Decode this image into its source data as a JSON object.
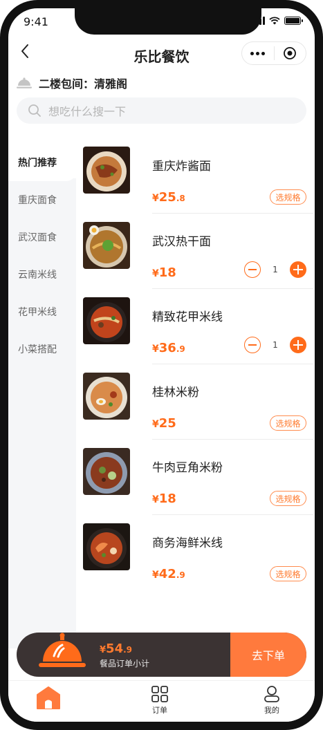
{
  "status": {
    "time": "9:41"
  },
  "nav": {
    "title": "乐比餐饮",
    "back_icon": "chevron-left-icon",
    "more_icon": "more-dots-icon",
    "close_icon": "target-circle-icon"
  },
  "room": {
    "label": "二楼包间：清雅阁",
    "icon": "cloche-icon"
  },
  "search": {
    "placeholder": "想吃什么搜一下",
    "icon": "search-icon"
  },
  "categories": [
    {
      "label": "热门推荐",
      "active": true
    },
    {
      "label": "重庆面食",
      "active": false
    },
    {
      "label": "武汉面食",
      "active": false
    },
    {
      "label": "云南米线",
      "active": false
    },
    {
      "label": "花甲米线",
      "active": false
    },
    {
      "label": "小菜搭配",
      "active": false
    }
  ],
  "dishes": [
    {
      "name": "重庆炸酱面",
      "currency": "¥",
      "price_int": "25",
      "price_dec": ".8",
      "action": "spec",
      "spec_label": "选规格"
    },
    {
      "name": "武汉热干面",
      "currency": "¥",
      "price_int": "18",
      "price_dec": "",
      "action": "stepper",
      "qty": "1"
    },
    {
      "name": "精致花甲米线",
      "currency": "¥",
      "price_int": "36",
      "price_dec": ".9",
      "action": "stepper",
      "qty": "1"
    },
    {
      "name": "桂林米粉",
      "currency": "¥",
      "price_int": "25",
      "price_dec": "",
      "action": "spec",
      "spec_label": "选规格"
    },
    {
      "name": "牛肉豆角米粉",
      "currency": "¥",
      "price_int": "18",
      "price_dec": "",
      "action": "spec",
      "spec_label": "选规格"
    },
    {
      "name": "商务海鲜米线",
      "currency": "¥",
      "price_int": "42",
      "price_dec": ".9",
      "action": "spec",
      "spec_label": "选规格"
    }
  ],
  "cart": {
    "currency": "¥",
    "total_int": "54",
    "total_dec": ".9",
    "subtitle": "餐品订单小计",
    "order_label": "去下单"
  },
  "tabs": [
    {
      "label": "",
      "icon": "home-icon"
    },
    {
      "label": "订单",
      "icon": "grid-icon"
    },
    {
      "label": "我的",
      "icon": "user-icon"
    }
  ],
  "colors": {
    "accent": "#ff6b1a",
    "cart_dark": "#3b3333",
    "order_button": "#ff7a3d"
  }
}
